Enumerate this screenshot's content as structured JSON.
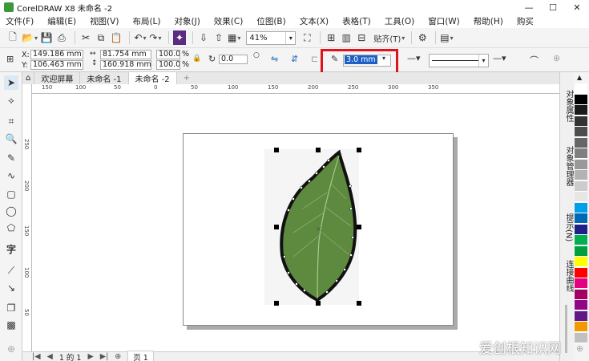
{
  "app": {
    "title": "CorelDRAW X8 未命名 -2",
    "window_controls": [
      "—",
      "☐",
      "✕"
    ]
  },
  "menu": [
    "文件(F)",
    "编辑(E)",
    "视图(V)",
    "布局(L)",
    "对象(J)",
    "效果(C)",
    "位图(B)",
    "文本(X)",
    "表格(T)",
    "工具(O)",
    "窗口(W)",
    "帮助(H)",
    "购买"
  ],
  "toolbar": {
    "zoom": "41%",
    "snap_label": "贴齐(T)"
  },
  "propbar": {
    "x_label": "X:",
    "x_value": "149.186 mm",
    "y_label": "Y:",
    "y_value": "106.463 mm",
    "w_value": "81.754 mm",
    "h_value": "160.918 mm",
    "scale_x": "100.0",
    "scale_y": "100.0",
    "percent": "%",
    "rotation": "0.0",
    "outline_width": "3.0 mm"
  },
  "tabs": {
    "home_icon": "home-icon",
    "items": [
      "欢迎屏幕",
      "未命名 -1",
      "未命名 -2"
    ],
    "add": "+"
  },
  "rulers": {
    "h_ticks": [
      "150",
      "100",
      "50",
      "0",
      "50",
      "100",
      "150",
      "200",
      "250",
      "300",
      "350"
    ],
    "v_ticks": [
      "250",
      "200",
      "150",
      "100",
      "50"
    ]
  },
  "dock": {
    "tabs": [
      "对象属性",
      "对象管理器",
      "提示(N)",
      "连接曲线"
    ]
  },
  "palette": {
    "colors": [
      "#ffffff",
      "#000000",
      "#1a1a1a",
      "#333333",
      "#4d4d4d",
      "#666666",
      "#808080",
      "#999999",
      "#b3b3b3",
      "#cccccc",
      "#e6e6e6",
      "#00a0e9",
      "#0068b7",
      "#1d2088",
      "#00b050",
      "#00a040",
      "#ffff00",
      "#ff0000",
      "#e4007f",
      "#a40062",
      "#920783",
      "#601986",
      "#f39800",
      "#c0c0c0"
    ]
  },
  "status": {
    "page_of": "1 的 1",
    "page_tab": "页 1"
  },
  "watermark": "爱创根知识网"
}
